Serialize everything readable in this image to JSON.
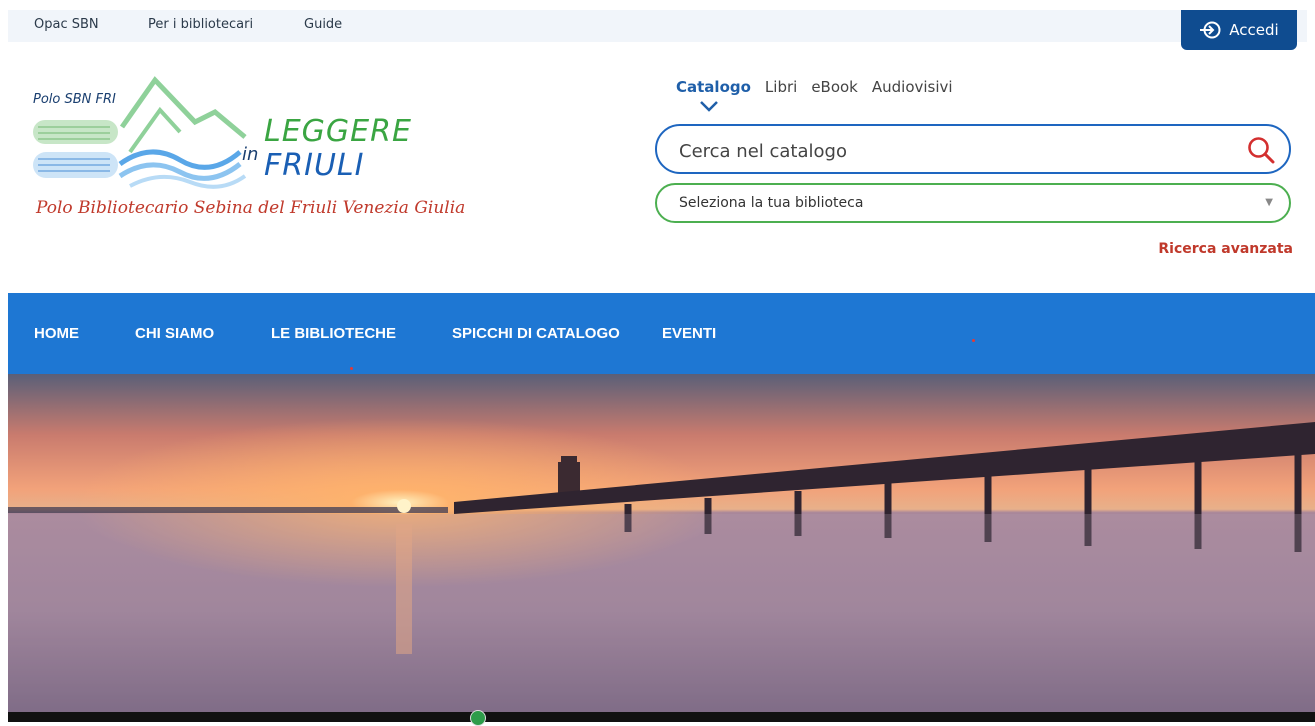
{
  "topbar": {
    "links": [
      "Opac SBN",
      "Per i bibliotecari",
      "Guide"
    ],
    "login_label": "Accedi"
  },
  "logo": {
    "polo": "Polo SBN FRI",
    "leggere": "LEGGERE",
    "in": "in",
    "friuli": "FRIULI",
    "subtitle": "Polo Bibliotecario Sebina del Friuli Venezia Giulia"
  },
  "search": {
    "tabs": [
      "Catalogo",
      "Libri",
      "eBook",
      "Audiovisivi"
    ],
    "active_tab": "Catalogo",
    "placeholder": "Cerca nel catalogo",
    "library_select": "Seleziona la tua biblioteca",
    "advanced_label": "Ricerca avanzata"
  },
  "nav": {
    "items": [
      "HOME",
      "CHI SIAMO",
      "LE BIBLIOTECHE",
      "SPICCHI DI CATALOGO",
      "EVENTI"
    ]
  },
  "colors": {
    "brand_blue": "#1e77d3",
    "login_blue": "#0f4c90",
    "accent_red": "#c0392b",
    "select_green": "#4caf50"
  },
  "icons": [
    "login-icon",
    "chevron-down-icon",
    "search-icon",
    "select-caret-icon"
  ]
}
